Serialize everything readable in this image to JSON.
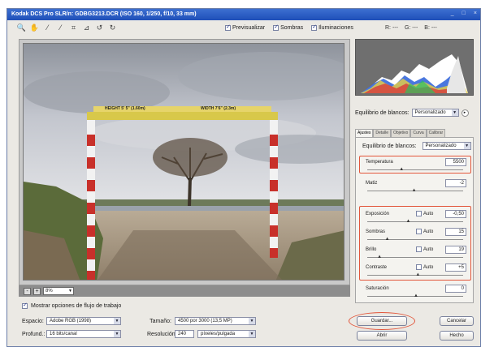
{
  "window": {
    "title": "Kodak DCS Pro SLR/n:  GDBG3213.DCR  (ISO 160, 1/250, f/10, 33 mm)",
    "controls": [
      "_",
      "□",
      "×"
    ]
  },
  "toolbar": {
    "tools": [
      "zoom-icon",
      "hand-icon",
      "eyedropper-icon",
      "color-sampler-icon",
      "crop-icon",
      "straighten-icon",
      "rotate-left-icon",
      "rotate-right-icon"
    ],
    "tool_glyphs": [
      "🔍",
      "✋",
      "⁄",
      "⁄",
      "⌗",
      "⊿",
      "↺",
      "↻"
    ],
    "preview_label": "Previsualizar",
    "shadows_label": "Sombras",
    "highlights_label": "Iluminaciones",
    "rgb": [
      "R: ---",
      "G: ---",
      "B: ---"
    ]
  },
  "status": {
    "zoom_out": "-",
    "zoom_in": "+",
    "zoom_value": "8%"
  },
  "bottom": {
    "workflow_label": "Mostrar opciones de flujo de trabajo",
    "space_label": "Espacio:",
    "space_value": "Adobe RGB (1998)",
    "depth_label": "Profund.:",
    "depth_value": "16 bits/canal",
    "size_label": "Tamaño:",
    "size_value": "4500 por 3000 (13,5 MP)",
    "res_label": "Resolución:",
    "res_value": "240",
    "res_unit": "píxeles/pulgada"
  },
  "photo": {
    "sign_left": "HEIGHT 5' 5\" (1.60m)",
    "sign_right": "WIDTH 7'6\" (2.3m)"
  },
  "right": {
    "wb_top_label": "Equilibrio de blancos:",
    "wb_top_value": "Personalizado",
    "tabs": [
      "Ajustes",
      "Detalle",
      "Objetivo",
      "Curva",
      "Calibrar"
    ],
    "panel_wb_label": "Equilibrio de blancos:",
    "panel_wb_value": "Personalizado",
    "rows": [
      {
        "label": "Temperatura",
        "value": "5500",
        "auto": false,
        "pos": 0.35
      },
      {
        "label": "Matiz",
        "value": "-2",
        "auto": false,
        "pos": 0.48
      },
      {
        "label": "Exposición",
        "value": "-0,50",
        "auto": true,
        "pos": 0.42
      },
      {
        "label": "Sombras",
        "value": "15",
        "auto": true,
        "pos": 0.2
      },
      {
        "label": "Brillo",
        "value": "19",
        "auto": true,
        "pos": 0.12
      },
      {
        "label": "Contraste",
        "value": "+5",
        "auto": true,
        "pos": 0.52
      },
      {
        "label": "Saturación",
        "value": "0",
        "auto": false,
        "pos": 0.5
      }
    ],
    "auto_label": "Auto",
    "save_label": "Guardar...",
    "open_label": "Abrir",
    "cancel_label": "Cancelar",
    "done_label": "Hecho"
  },
  "colors": {
    "highlight": "#e2553a",
    "titlebar": "#2b5cc4",
    "frame_red": "#c8302a"
  }
}
